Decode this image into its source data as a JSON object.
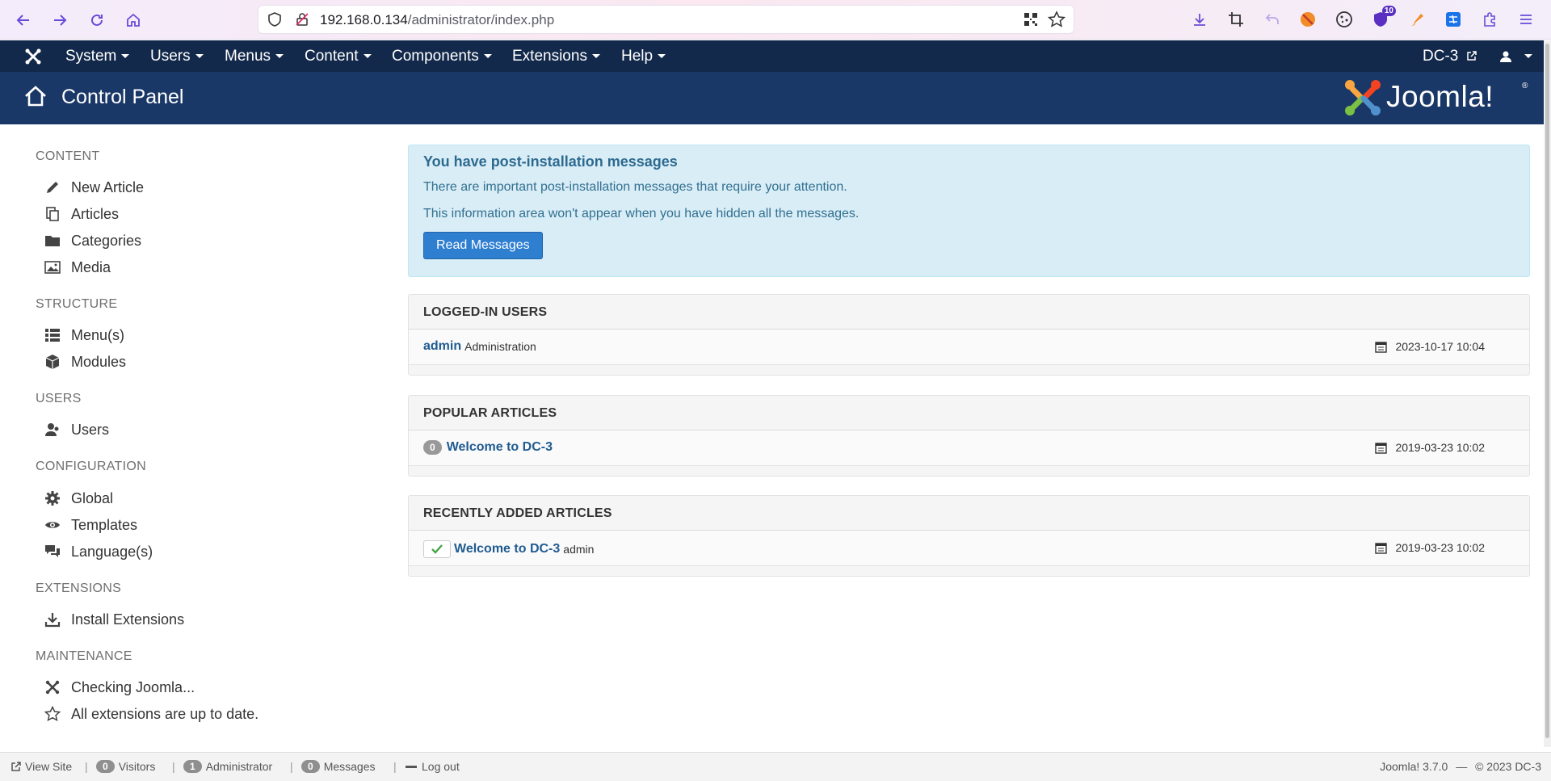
{
  "browser": {
    "url_host": "192.168.0.134",
    "url_path": "/administrator/index.php",
    "extension_badge": "10"
  },
  "topnav": {
    "menus": [
      "System",
      "Users",
      "Menus",
      "Content",
      "Components",
      "Extensions",
      "Help"
    ],
    "site_link": "DC-3"
  },
  "header": {
    "title": "Control Panel",
    "brand": "Joomla!",
    "brand_reg": "®"
  },
  "sidebar": {
    "sections": [
      {
        "title": "CONTENT",
        "items": [
          {
            "label": "New Article",
            "icon": "pencil-icon"
          },
          {
            "label": "Articles",
            "icon": "copy-icon"
          },
          {
            "label": "Categories",
            "icon": "folder-icon"
          },
          {
            "label": "Media",
            "icon": "image-icon"
          }
        ]
      },
      {
        "title": "STRUCTURE",
        "items": [
          {
            "label": "Menu(s)",
            "icon": "list-icon"
          },
          {
            "label": "Modules",
            "icon": "cube-icon"
          }
        ]
      },
      {
        "title": "USERS",
        "items": [
          {
            "label": "Users",
            "icon": "users-icon"
          }
        ]
      },
      {
        "title": "CONFIGURATION",
        "items": [
          {
            "label": "Global",
            "icon": "cog-icon"
          },
          {
            "label": "Templates",
            "icon": "eye-icon"
          },
          {
            "label": "Language(s)",
            "icon": "comments-icon"
          }
        ]
      },
      {
        "title": "EXTENSIONS",
        "items": [
          {
            "label": "Install Extensions",
            "icon": "download-icon"
          }
        ]
      },
      {
        "title": "MAINTENANCE",
        "items": [
          {
            "label": "Checking Joomla...",
            "icon": "joomla-icon"
          },
          {
            "label": "All extensions are up to date.",
            "icon": "star-icon"
          }
        ]
      }
    ]
  },
  "alert": {
    "heading": "You have post-installation messages",
    "line1": "There are important post-installation messages that require your attention.",
    "line2": "This information area won't appear when you have hidden all the messages.",
    "button": "Read Messages"
  },
  "panels": {
    "logged_in": {
      "title": "LOGGED-IN USERS",
      "user": "admin",
      "role": "Administration",
      "date": "2023-10-17 10:04"
    },
    "popular": {
      "title": "POPULAR ARTICLES",
      "hits": "0",
      "article": "Welcome to DC-3",
      "date": "2019-03-23 10:02"
    },
    "recent": {
      "title": "RECENTLY ADDED ARTICLES",
      "article": "Welcome to DC-3",
      "author": "admin",
      "date": "2019-03-23 10:02"
    }
  },
  "footer": {
    "view_site": "View Site",
    "visitors_count": "0",
    "visitors_label": "Visitors",
    "admin_count": "1",
    "admin_label": "Administrator",
    "messages_count": "0",
    "messages_label": "Messages",
    "logout": "Log out",
    "version": "Joomla! 3.7.0",
    "dash": "—",
    "copyright": "© 2023 DC-3"
  },
  "colors": {
    "topnav": "#13294b",
    "header": "#1a3867",
    "alert_bg": "#d9edf7",
    "button": "#2f7fd1",
    "link": "#1f5b91"
  }
}
